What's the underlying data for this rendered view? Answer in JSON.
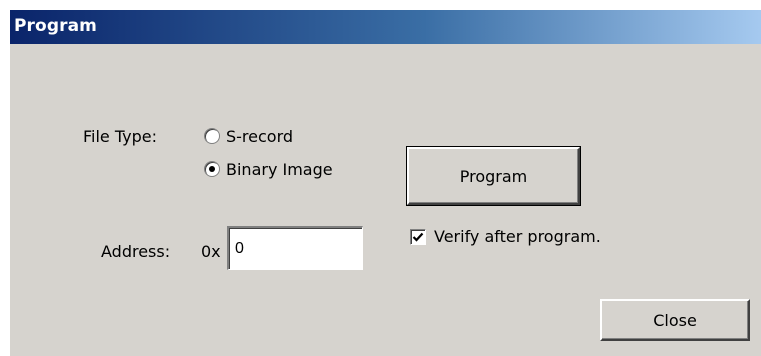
{
  "window": {
    "title": "Program"
  },
  "file_type": {
    "label": "File Type:",
    "options": [
      {
        "label": "S-record",
        "selected": false
      },
      {
        "label": "Binary Image",
        "selected": true
      }
    ]
  },
  "address": {
    "label": "Address:",
    "prefix": "0x",
    "value": "0"
  },
  "program_button": {
    "label": "Program"
  },
  "verify": {
    "label": "Verify after program.",
    "checked": true
  },
  "close_button": {
    "label": "Close"
  },
  "colors": {
    "title_gradient_start": "#0a246a",
    "title_gradient_end": "#a6caf0",
    "dialog_bg": "#d6d3ce"
  },
  "icons": {
    "checkbox_check": "check-icon"
  }
}
